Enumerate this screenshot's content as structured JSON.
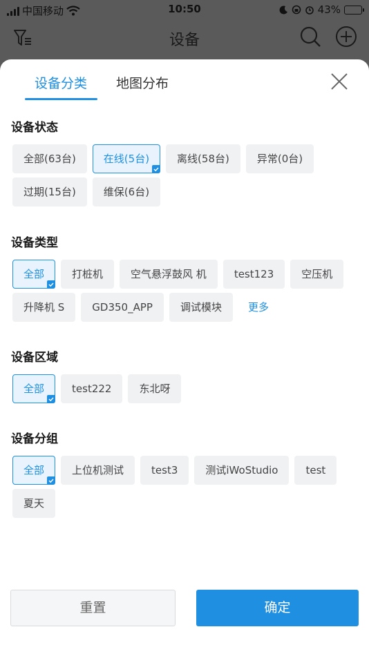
{
  "status_bar": {
    "carrier": "中国移动",
    "time": "10:50",
    "battery": "43%",
    "battery_level": 0.43
  },
  "nav": {
    "title": "设备",
    "left_icon": "filter-icon",
    "right_icons": [
      "search-icon",
      "add-circle-icon"
    ]
  },
  "tabs": [
    {
      "label": "设备分类",
      "active": true
    },
    {
      "label": "地图分布",
      "active": false
    }
  ],
  "sections": [
    {
      "title": "设备状态",
      "chips": [
        {
          "label": "全部(63台)",
          "selected": false
        },
        {
          "label": "在线(5台)",
          "selected": true
        },
        {
          "label": "离线(58台)",
          "selected": false
        },
        {
          "label": "异常(0台)",
          "selected": false
        },
        {
          "label": "过期(15台)",
          "selected": false
        },
        {
          "label": "维保(6台)",
          "selected": false
        }
      ]
    },
    {
      "title": "设备类型",
      "chips": [
        {
          "label": "全部",
          "selected": true
        },
        {
          "label": "打桩机",
          "selected": false
        },
        {
          "label": "空气悬浮鼓风 机",
          "selected": false
        },
        {
          "label": "test123",
          "selected": false
        },
        {
          "label": "空压机",
          "selected": false
        },
        {
          "label": "升降机 S",
          "selected": false
        },
        {
          "label": "GD350_APP",
          "selected": false
        },
        {
          "label": "调试模块",
          "selected": false
        }
      ],
      "more_label": "更多"
    },
    {
      "title": "设备区域",
      "chips": [
        {
          "label": "全部",
          "selected": true
        },
        {
          "label": "test222",
          "selected": false
        },
        {
          "label": "东北呀",
          "selected": false
        }
      ]
    },
    {
      "title": "设备分组",
      "chips": [
        {
          "label": "全部",
          "selected": true
        },
        {
          "label": "上位机测试",
          "selected": false
        },
        {
          "label": "test3",
          "selected": false
        },
        {
          "label": "测试iWoStudio",
          "selected": false
        },
        {
          "label": "test",
          "selected": false
        },
        {
          "label": "夏天",
          "selected": false
        }
      ]
    }
  ],
  "footer": {
    "reset_label": "重置",
    "confirm_label": "确定"
  },
  "colors": {
    "accent": "#1e8fe1",
    "chip_bg": "#f0f1f3",
    "overlay": "#5a5a5a"
  }
}
